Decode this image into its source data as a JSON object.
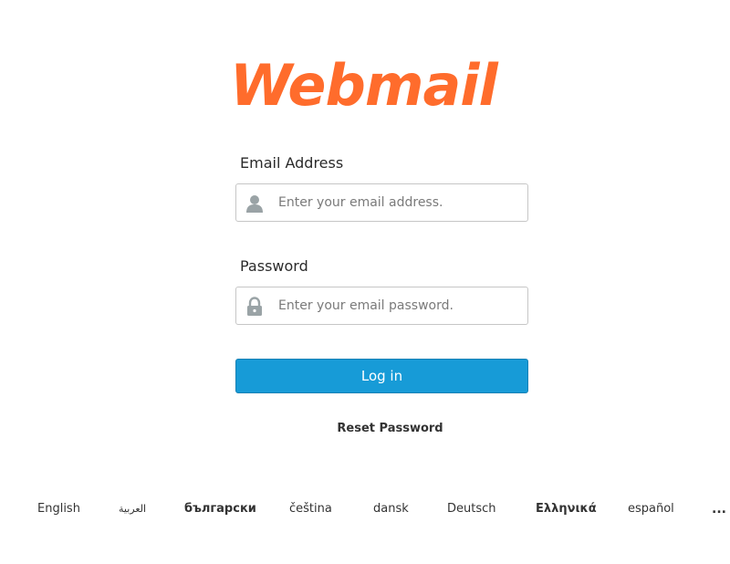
{
  "brand": {
    "logo_text": "Webmail",
    "logo_color": "#ff6c2c"
  },
  "form": {
    "email_label": "Email Address",
    "email_placeholder": "Enter your email address.",
    "email_value": "",
    "email_icon": "user-icon",
    "password_label": "Password",
    "password_placeholder": "Enter your email password.",
    "password_value": "",
    "password_icon": "lock-icon",
    "login_label": "Log in",
    "login_color": "#179bd7",
    "reset_label": "Reset Password"
  },
  "languages": {
    "items": [
      "English",
      "العربية",
      "български",
      "čeština",
      "dansk",
      "Deutsch",
      "Ελληνικά",
      "español"
    ],
    "more_label": "..."
  }
}
